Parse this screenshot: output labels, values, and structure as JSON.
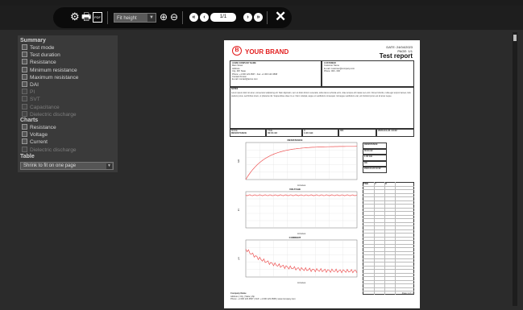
{
  "toolbar": {
    "zoom_value": "Fit height",
    "page_indicator": "1/1",
    "icons": [
      "gear-icon",
      "print-icon",
      "pdf-icon",
      "zoom-in-icon",
      "zoom-out-icon",
      "first-page-icon",
      "prev-page-icon",
      "next-page-icon",
      "last-page-icon",
      "close-icon"
    ],
    "glyph_pdf": "PDF"
  },
  "sidebar": {
    "summary_title": "Summary",
    "summary_items": [
      {
        "label": "Test mode",
        "enabled": true
      },
      {
        "label": "Test duration",
        "enabled": true
      },
      {
        "label": "Resistance",
        "enabled": true
      },
      {
        "label": "Minimum resistance",
        "enabled": true
      },
      {
        "label": "Maximum resistance",
        "enabled": true
      },
      {
        "label": "DAI",
        "enabled": true
      },
      {
        "label": "PI",
        "enabled": false
      },
      {
        "label": "SVT",
        "enabled": false
      },
      {
        "label": "Capacitance",
        "enabled": false
      },
      {
        "label": "Dielectric discharge",
        "enabled": false
      }
    ],
    "charts_title": "Charts",
    "chart_items": [
      {
        "label": "Resistance",
        "enabled": true
      },
      {
        "label": "Voltage",
        "enabled": true
      },
      {
        "label": "Current",
        "enabled": true
      },
      {
        "label": "Dielectric discharge",
        "enabled": false
      }
    ],
    "table_title": "Table",
    "table_value": "Shrink to fit on one page"
  },
  "report": {
    "brand_letter": "B",
    "brand": "YOUR BRAND",
    "date": "DATE: 24/04/2023",
    "page": "PAGE: 1/1",
    "title": "Test report",
    "company_lines": [
      "ACME COMPANY NAME",
      "Main Street",
      "Address",
      "City, ZIP, State",
      "Phone: +1 000 123 4567 - Fax: +1 000 123 4568",
      "",
      "Contact Person",
      "E-mail: contact@acme.com"
    ],
    "customer_lines": [
      "CUSTOMER",
      "Customer Name",
      "E-mail: customer@company.com",
      "Phone: 000 - 000"
    ],
    "notes_label": "NOTES",
    "notes_text": "Lorem ipsum dolor sit amet, consectetur adipiscing elit. Nam dignissim, sem ut dolor dictum venenatis, tellus lacus vehicula enim, vitae tempus elit massa nec enim. Donec lobortis, nulla eget tempor laoreet, felis pretium purus, sed finibus lorem, ut pharetra nisl. Suspendisse vitae mi ex. Nunc volutpat, augue ut vestibulum consequat, nisl augue vestibulum erat, vel tincidunt purus est sit amet neque.",
    "summary_cells": [
      {
        "k": "MODE",
        "v": "RESISTANCE"
      },
      {
        "k": "TIME",
        "v": "00:01:22"
      },
      {
        "k": "R",
        "v": "1.00 GΩ"
      },
      {
        "k": "",
        "v": "OK"
      },
      {
        "k": "",
        "v": "2023-04-24 10:22"
      }
    ],
    "charts": [
      {
        "title": "RESISTANCE",
        "xlabel": "minutes",
        "ylabel": "GΩ"
      },
      {
        "title": "VOLTAGE",
        "xlabel": "minutes",
        "ylabel": "kV"
      },
      {
        "title": "CURRENT",
        "xlabel": "minutes",
        "ylabel": "μA"
      }
    ],
    "right_table_header": [
      "TIME",
      "V",
      "R"
    ],
    "footer_lines": [
      "Company Name",
      "Address | City | State | Zip",
      "Phone: +1 000 123 4567 | FAX: +1 000 123 4568 | www.company.com"
    ],
    "footer_right": "Page 1 of 1"
  },
  "colors": {
    "toolbar": "#1e1e1e",
    "sidebar": "#3a3a3a",
    "brand": "#e21d1d",
    "chart_line": "#ee5555"
  }
}
